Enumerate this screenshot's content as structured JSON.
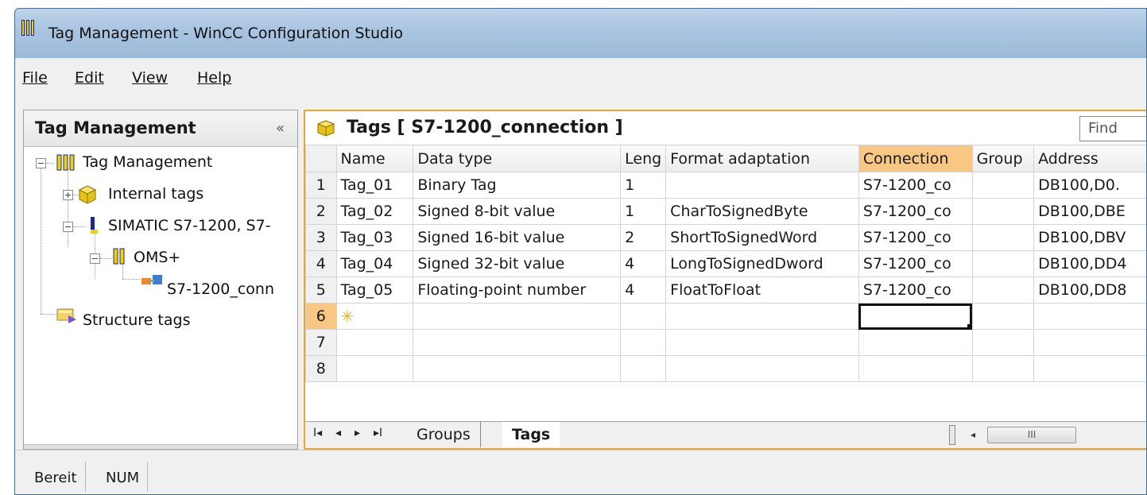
{
  "window": {
    "title": "Tag Management - WinCC Configuration Studio",
    "logo_glyph": "!!!"
  },
  "menu": {
    "items": [
      "File",
      "Edit",
      "View",
      "Help"
    ]
  },
  "navigation": {
    "header": "Tag Management",
    "collapse_glyph": "«",
    "tree": [
      {
        "label": "Tag Management",
        "icon": "wincc-logo-icon"
      },
      {
        "label": "Internal tags",
        "icon": "cube-group-icon"
      },
      {
        "label": "SIMATIC S7-1200, S7-",
        "icon": "driver-icon"
      },
      {
        "label": "OMS+",
        "icon": "channel-icon"
      },
      {
        "label": "S7-1200_conn",
        "icon": "connection-icon"
      },
      {
        "label": "Structure tags",
        "icon": "structure-icon"
      }
    ]
  },
  "editor": {
    "title": "Tags [ S7-1200_connection ]",
    "find_placeholder": "Find",
    "columns": [
      "Name",
      "Data type",
      "Leng",
      "Format adaptation",
      "Connection",
      "Group",
      "Address"
    ],
    "rows": [
      {
        "n": "1",
        "name": "Tag_01",
        "type": "Binary Tag",
        "len": "1",
        "format": "",
        "connection": "S7-1200_co",
        "group": "",
        "address": "DB100,D0."
      },
      {
        "n": "2",
        "name": "Tag_02",
        "type": "Signed 8-bit value",
        "len": "1",
        "format": "CharToSignedByte",
        "connection": "S7-1200_co",
        "group": "",
        "address": "DB100,DBE"
      },
      {
        "n": "3",
        "name": "Tag_03",
        "type": "Signed 16-bit value",
        "len": "2",
        "format": "ShortToSignedWord",
        "connection": "S7-1200_co",
        "group": "",
        "address": "DB100,DBV"
      },
      {
        "n": "4",
        "name": "Tag_04",
        "type": "Signed 32-bit value",
        "len": "4",
        "format": "LongToSignedDword",
        "connection": "S7-1200_co",
        "group": "",
        "address": "DB100,DD4"
      },
      {
        "n": "5",
        "name": "Tag_05",
        "type": "Floating-point number",
        "len": "4",
        "format": "FloatToFloat",
        "connection": "S7-1200_co",
        "group": "",
        "address": "DB100,DD8"
      },
      {
        "n": "6",
        "name": "",
        "type": "",
        "len": "",
        "format": "",
        "connection": "",
        "group": "",
        "address": ""
      },
      {
        "n": "7",
        "name": "",
        "type": "",
        "len": "",
        "format": "",
        "connection": "",
        "group": "",
        "address": ""
      },
      {
        "n": "8",
        "name": "",
        "type": "",
        "len": "",
        "format": "",
        "connection": "",
        "group": "",
        "address": ""
      }
    ],
    "tabs": [
      "Groups",
      "Tags"
    ],
    "nav_glyphs": [
      "I◂",
      "◂",
      "▸",
      "▸I"
    ],
    "scroll_glyphs": {
      "left": "◂",
      "thumb": "III"
    }
  },
  "status": {
    "items": [
      "Bereit",
      "NUM"
    ]
  },
  "colors": {
    "selection": "#f7c783",
    "accent": "#e8a634",
    "title_bar": "#a9c4e0"
  }
}
